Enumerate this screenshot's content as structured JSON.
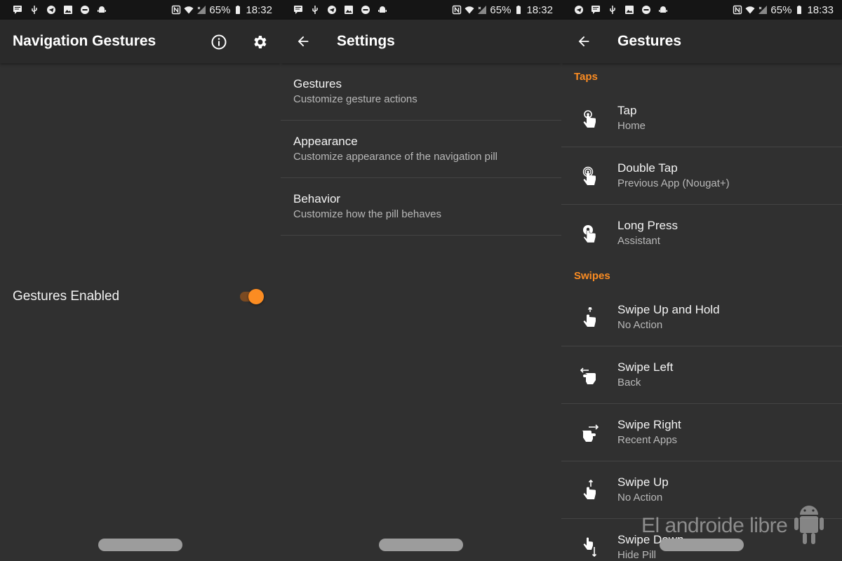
{
  "panel1": {
    "status": {
      "battery": "65%",
      "time": "18:32"
    },
    "title": "Navigation Gestures",
    "toggle_label": "Gestures Enabled"
  },
  "panel2": {
    "status": {
      "battery": "65%",
      "time": "18:32"
    },
    "title": "Settings",
    "items": [
      {
        "title": "Gestures",
        "subtitle": "Customize gesture actions"
      },
      {
        "title": "Appearance",
        "subtitle": "Customize appearance of the navigation pill"
      },
      {
        "title": "Behavior",
        "subtitle": "Customize how the pill behaves"
      }
    ]
  },
  "panel3": {
    "status": {
      "battery": "65%",
      "time": "18:33"
    },
    "title": "Gestures",
    "sections": [
      {
        "label": "Taps",
        "items": [
          {
            "title": "Tap",
            "subtitle": "Home",
            "icon": "tap-icon"
          },
          {
            "title": "Double Tap",
            "subtitle": "Previous App (Nougat+)",
            "icon": "double-tap-icon"
          },
          {
            "title": "Long Press",
            "subtitle": "Assistant",
            "icon": "long-press-icon"
          }
        ]
      },
      {
        "label": "Swipes",
        "items": [
          {
            "title": "Swipe Up and Hold",
            "subtitle": "No Action",
            "icon": "swipe-up-hold-icon"
          },
          {
            "title": "Swipe Left",
            "subtitle": "Back",
            "icon": "swipe-left-icon"
          },
          {
            "title": "Swipe Right",
            "subtitle": "Recent Apps",
            "icon": "swipe-right-icon"
          },
          {
            "title": "Swipe Up",
            "subtitle": "No Action",
            "icon": "swipe-up-icon"
          },
          {
            "title": "Swipe Down",
            "subtitle": "Hide Pill",
            "icon": "swipe-down-icon"
          }
        ]
      }
    ]
  },
  "toggle_on": true,
  "accent_color": "#fb8c22",
  "watermark": "El androide libre"
}
